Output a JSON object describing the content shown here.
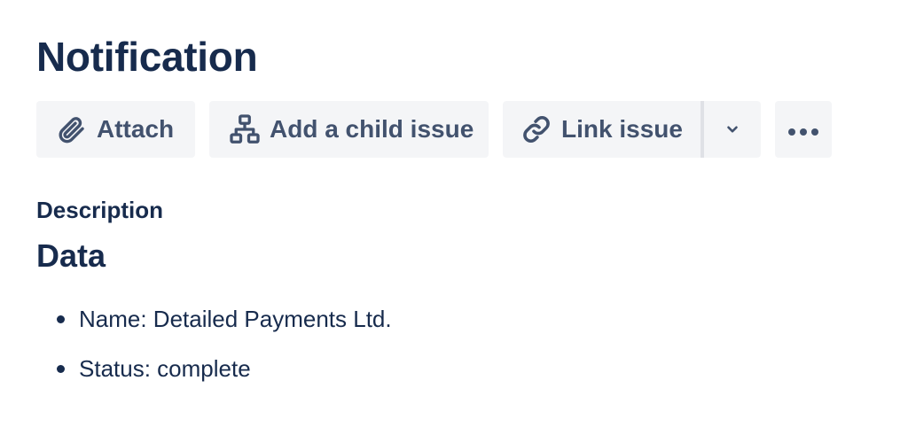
{
  "page": {
    "title": "Notification"
  },
  "toolbar": {
    "attach_label": "Attach",
    "add_child_label": "Add a child issue",
    "link_issue_label": "Link issue",
    "more_label": "•••"
  },
  "icons": {
    "attach": "paperclip-icon",
    "add_child": "hierarchy-icon",
    "link": "link-icon",
    "dropdown": "chevron-down-icon",
    "more": "more-icon"
  },
  "description": {
    "label": "Description",
    "heading": "Data",
    "items": [
      {
        "text": "Name: Detailed Payments Ltd."
      },
      {
        "text": "Status: complete"
      }
    ]
  },
  "colors": {
    "text": "#172b4d",
    "button_bg": "#f4f5f7",
    "button_text": "#42526e"
  }
}
